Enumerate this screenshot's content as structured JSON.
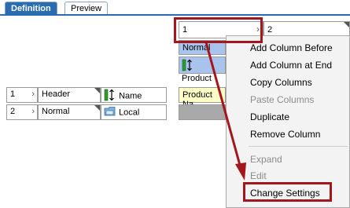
{
  "tabs": {
    "definition": "Definition",
    "preview": "Preview"
  },
  "columns": {
    "col1": "1",
    "col2": "2"
  },
  "column1": {
    "row1": "Normal",
    "row2": "Product",
    "row3": "Product Na"
  },
  "rows": [
    {
      "num": "1",
      "type": "Header",
      "name": "Name"
    },
    {
      "num": "2",
      "type": "Normal",
      "name": "Local"
    }
  ],
  "menu": {
    "add_before": "Add Column Before",
    "add_end": "Add Column at End",
    "copy": "Copy Columns",
    "paste": "Paste Columns",
    "duplicate": "Duplicate",
    "remove": "Remove Column",
    "expand": "Expand",
    "edit": "Edit",
    "change_settings": "Change Settings"
  }
}
